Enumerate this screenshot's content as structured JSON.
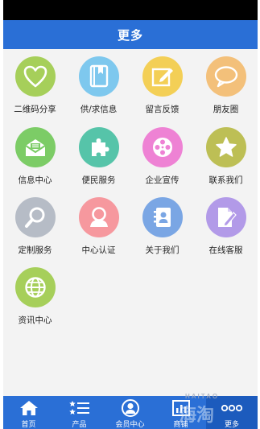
{
  "header": {
    "title": "更多"
  },
  "grid": {
    "items": [
      {
        "label": "二维码分享",
        "icon": "heart-icon",
        "color": "#a6cf5a"
      },
      {
        "label": "供/求信息",
        "icon": "book-icon",
        "color": "#7ec8ee"
      },
      {
        "label": "留言反馈",
        "icon": "edit-icon",
        "color": "#f3cf56"
      },
      {
        "label": "朋友圈",
        "icon": "chat-bubble-icon",
        "color": "#f3c07a"
      },
      {
        "label": "信息中心",
        "icon": "mail-icon",
        "color": "#7ccc66"
      },
      {
        "label": "便民服务",
        "icon": "puzzle-icon",
        "color": "#56c4a9"
      },
      {
        "label": "企业宣传",
        "icon": "film-reel-icon",
        "color": "#ee82d4"
      },
      {
        "label": "联系我们",
        "icon": "star-icon",
        "color": "#bdbf55"
      },
      {
        "label": "定制服务",
        "icon": "search-icon",
        "color": "#b6bcc6"
      },
      {
        "label": "中心认证",
        "icon": "user-icon",
        "color": "#f6989e"
      },
      {
        "label": "关于我们",
        "icon": "contact-book-icon",
        "color": "#7aa6e4"
      },
      {
        "label": "在线客服",
        "icon": "note-pencil-icon",
        "color": "#b29ae8"
      },
      {
        "label": "资讯中心",
        "icon": "globe-icon",
        "color": "#a6cf5a"
      }
    ]
  },
  "tabbar": {
    "tabs": [
      {
        "label": "首页",
        "icon": "home-icon"
      },
      {
        "label": "产品",
        "icon": "list-icon"
      },
      {
        "label": "会员中心",
        "icon": "user-circle-icon"
      },
      {
        "label": "商铺",
        "icon": "chart-icon"
      },
      {
        "label": "更多",
        "icon": "more-dots-icon"
      }
    ]
  },
  "watermark": {
    "top": "HAITAO",
    "main": "海淘"
  },
  "colors": {
    "brand": "#2a6fd6",
    "background": "#f3f3f3"
  }
}
